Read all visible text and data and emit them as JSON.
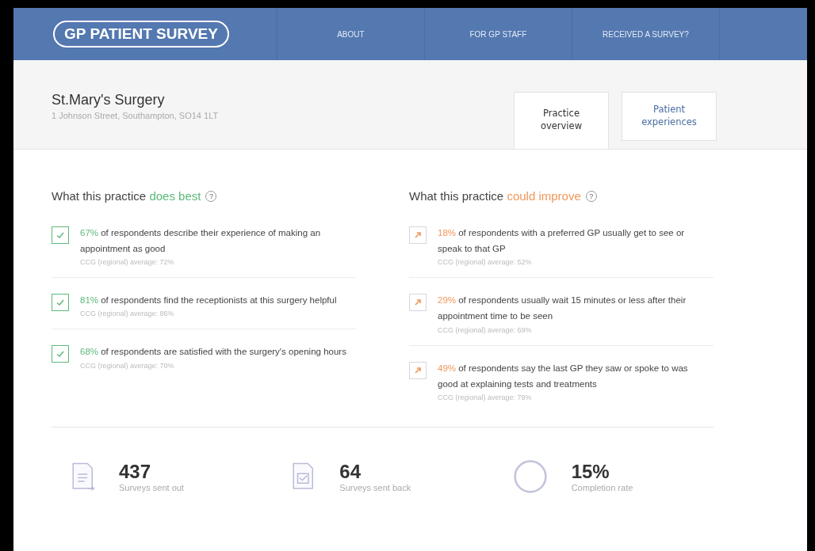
{
  "header": {
    "logo": "GP PATIENT SURVEY",
    "nav": [
      "ABOUT",
      "FOR GP STAFF",
      "RECEIVED A SURVEY?"
    ]
  },
  "practice": {
    "name": "St.Mary's Surgery",
    "address": "1 Johnson Street, Southampton, SO14 1LT"
  },
  "tabs": [
    {
      "label": "Practice overview",
      "selected": true
    },
    {
      "label": "Patient experiences",
      "selected": false
    }
  ],
  "columns": [
    {
      "kind": "best",
      "heading": "What this practice",
      "highlight": "does best",
      "help": "?",
      "items": [
        {
          "percent": "67%",
          "text": "of respondents describe their experience of making an appointment as good",
          "average": "CCG (regional) average: 72%"
        },
        {
          "percent": "81%",
          "text": "of respondents find the receptionists at this surgery helpful",
          "average": "CCG (regional) average: 86%"
        },
        {
          "percent": "68%",
          "text": "of respondents are satisfied with the surgery's opening hours",
          "average": "CCG (regional) average: 70%"
        }
      ]
    },
    {
      "kind": "improve",
      "heading": "What this practice",
      "highlight": "could improve",
      "help": "?",
      "items": [
        {
          "percent": "18%",
          "text": "of respondents with a preferred GP usually get to see or speak to that GP",
          "average": "CCG (regional) average: 52%"
        },
        {
          "percent": "29%",
          "text": "of respondents usually wait 15 minutes or less after their appointment time to be seen",
          "average": "CCG (regional) average: 69%"
        },
        {
          "percent": "49%",
          "text": "of respondents say the last GP they saw or spoke to was good at explaining tests and treatments",
          "average": "CCG (regional) average: 79%"
        }
      ]
    }
  ],
  "stats": [
    {
      "kind": "sent",
      "value": "437",
      "label": "Surveys sent out"
    },
    {
      "kind": "back",
      "value": "64",
      "label": "Surveys sent back"
    },
    {
      "kind": "rate",
      "value": "15%",
      "label": "Completion rate"
    }
  ]
}
